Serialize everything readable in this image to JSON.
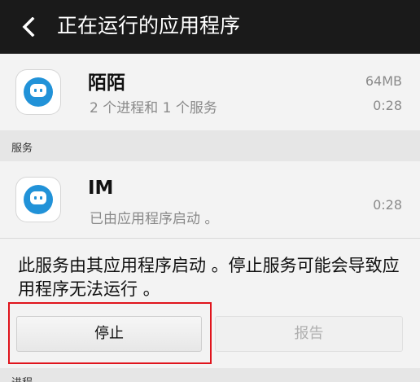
{
  "header": {
    "title": "正在运行的应用程序"
  },
  "app": {
    "name": "陌陌",
    "detail": "2 个进程和 1 个服务",
    "memory": "64MB",
    "time": "0:28"
  },
  "services_section": {
    "label": "服务"
  },
  "service": {
    "name": "IM",
    "detail": "已由应用程序启动 。",
    "time": "0:28"
  },
  "description": "此服务由其应用程序启动 。停止服务可能会导致应用程序无法运行 。",
  "buttons": {
    "stop": "停止",
    "report": "报告"
  },
  "processes_section": {
    "label": "进程"
  },
  "colors": {
    "highlight": "#e0141c",
    "app_icon": "#2192d8"
  }
}
